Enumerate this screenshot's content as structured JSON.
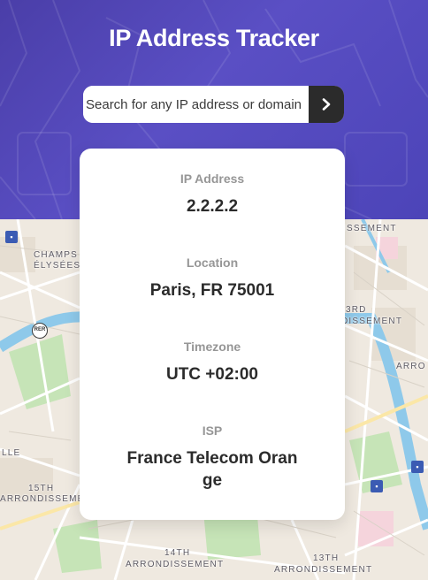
{
  "header": {
    "title": "IP Address Tracker"
  },
  "search": {
    "placeholder": "Search for any IP address or domain",
    "value": ""
  },
  "info": {
    "ip_label": "IP Address",
    "ip_value": "2.2.2.2",
    "location_label": "Location",
    "location_value": "Paris, FR 75001",
    "timezone_label": "Timezone",
    "timezone_value": "UTC +02:00",
    "isp_label": "ISP",
    "isp_value": "France Telecom Orange"
  },
  "map": {
    "labels": [
      "CHAMPS",
      "ÉLYSÉES",
      "LLE",
      "15TH",
      "ARRONDISSEMENT",
      "14TH",
      "ARRONDISSEMENT",
      "13TH",
      "ARRONDISSEMENT",
      "ISSEMENT",
      "3RD",
      "DISSEMENT",
      "ARRO"
    ],
    "rer_badge": "RER"
  },
  "colors": {
    "hero": "#5046b8",
    "button": "#2b2b2b",
    "river": "#8ec9ea",
    "park": "#c4e3b5"
  }
}
